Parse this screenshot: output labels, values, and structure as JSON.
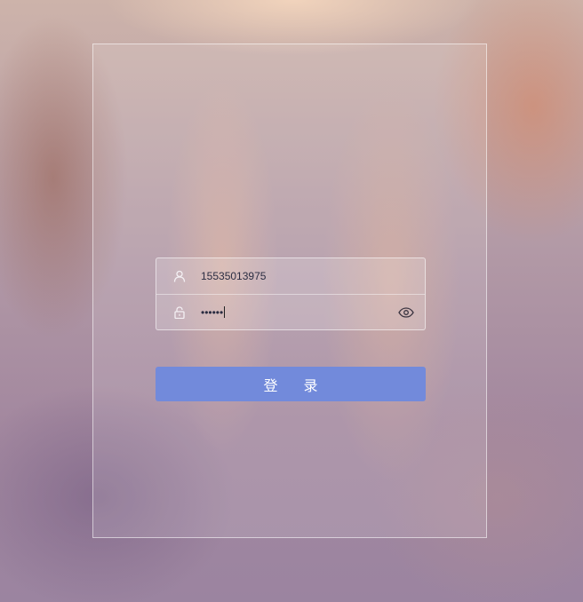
{
  "login": {
    "username_value": "15535013975",
    "password_masked": "••••••",
    "submit_label": "登 录"
  },
  "icons": {
    "user": "user-icon",
    "lock": "lock-icon",
    "visibility": "eye-icon"
  },
  "colors": {
    "button": "#728adb",
    "button_text": "#ffffff",
    "input_text": "#2b2d42"
  }
}
